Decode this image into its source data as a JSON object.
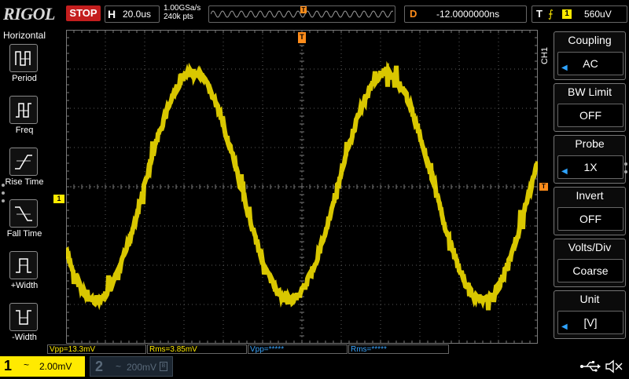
{
  "top_bar": {
    "logo": "RIGOL",
    "run_status": "STOP",
    "horizontal": {
      "label": "H",
      "timebase": "20.0us"
    },
    "sample_rate": "1.00GSa/s",
    "memory_depth": "240k pts",
    "trigger_position_marker": "T",
    "delay": {
      "label": "D",
      "value": "-12.0000000ns"
    },
    "trigger": {
      "label": "T",
      "edge_icon": "rising-edge-icon",
      "source": "1",
      "level": "560uV"
    }
  },
  "left_menu": {
    "title": "Horizontal",
    "items": [
      {
        "label": "Period",
        "icon": "period-icon"
      },
      {
        "label": "Freq",
        "icon": "freq-icon"
      },
      {
        "label": "Rise Time",
        "icon": "rise-time-icon"
      },
      {
        "label": "Fall Time",
        "icon": "fall-time-icon"
      },
      {
        "label": "+Width",
        "icon": "positive-width-icon"
      },
      {
        "label": "-Width",
        "icon": "negative-width-icon"
      }
    ]
  },
  "waveform": {
    "channel_marker": "1",
    "trigger_level_marker": "T",
    "trigger_pos_marker": "T",
    "color": "#ffea00"
  },
  "right_menu": {
    "channel_tag": "CH1",
    "items": [
      {
        "title": "Coupling",
        "value": "AC",
        "has_arrow": true
      },
      {
        "title": "BW Limit",
        "value": "OFF",
        "has_arrow": false
      },
      {
        "title": "Probe",
        "value": "1X",
        "has_arrow": true
      },
      {
        "title": "Invert",
        "value": "OFF",
        "has_arrow": false
      },
      {
        "title": "Volts/Div",
        "value": "Coarse",
        "has_arrow": false
      },
      {
        "title": "Unit",
        "value": "[V]",
        "has_arrow": true
      }
    ]
  },
  "measurements": [
    {
      "text": "Vpp=13.3mV",
      "color": "#ffea00"
    },
    {
      "text": "Rms=3.85mV",
      "color": "#ffea00"
    },
    {
      "text": "Vpp=*****",
      "color": "#3aa6ff"
    },
    {
      "text": "Rms=*****",
      "color": "#3aa6ff"
    }
  ],
  "bottom_bar": {
    "ch1": {
      "number": "1",
      "coupling": "~",
      "scale": "2.00mV"
    },
    "ch2": {
      "number": "2",
      "coupling": "~",
      "scale": "200mV",
      "bw_limit": "B"
    },
    "status_icons": [
      "usb-icon",
      "speaker-muted-icon"
    ]
  }
}
